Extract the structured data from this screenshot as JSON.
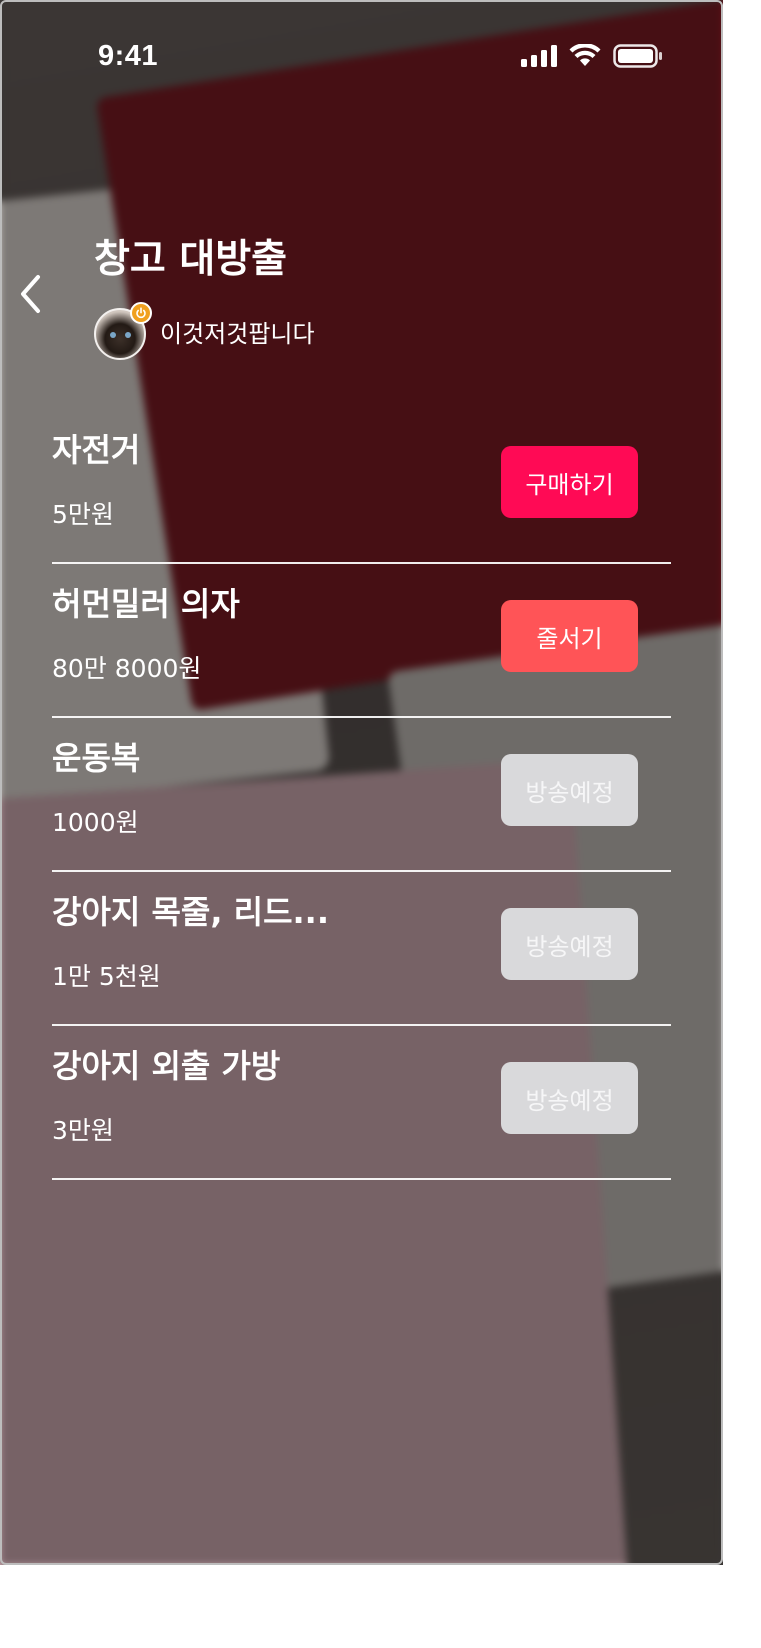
{
  "status_bar": {
    "time": "9:41",
    "icons": [
      "signal-icon",
      "wifi-icon",
      "battery-icon"
    ]
  },
  "header": {
    "back_icon": "chevron-left-icon",
    "title": "창고 대방출",
    "seller": {
      "name": "이것저것팝니다",
      "badge_icon": "live-power-icon"
    }
  },
  "products": [
    {
      "name": "자전거",
      "price": "5만원",
      "action": "구매하기",
      "action_type": "buy"
    },
    {
      "name": "허먼밀러 의자",
      "price": "80만 8000원",
      "action": "줄서기",
      "action_type": "queue"
    },
    {
      "name": "운동복",
      "price": "1000원",
      "action": "방송예정",
      "action_type": "scheduled"
    },
    {
      "name": "강아지 목줄, 리드...",
      "price": "1만 5천원",
      "action": "방송예정",
      "action_type": "scheduled"
    },
    {
      "name": "강아지 외출 가방",
      "price": "3만원",
      "action": "방송예정",
      "action_type": "scheduled"
    }
  ],
  "colors": {
    "buy": "#ff0a55",
    "queue": "#ff5457",
    "scheduled": "#d9d9db",
    "live_badge": "#f0a020"
  }
}
